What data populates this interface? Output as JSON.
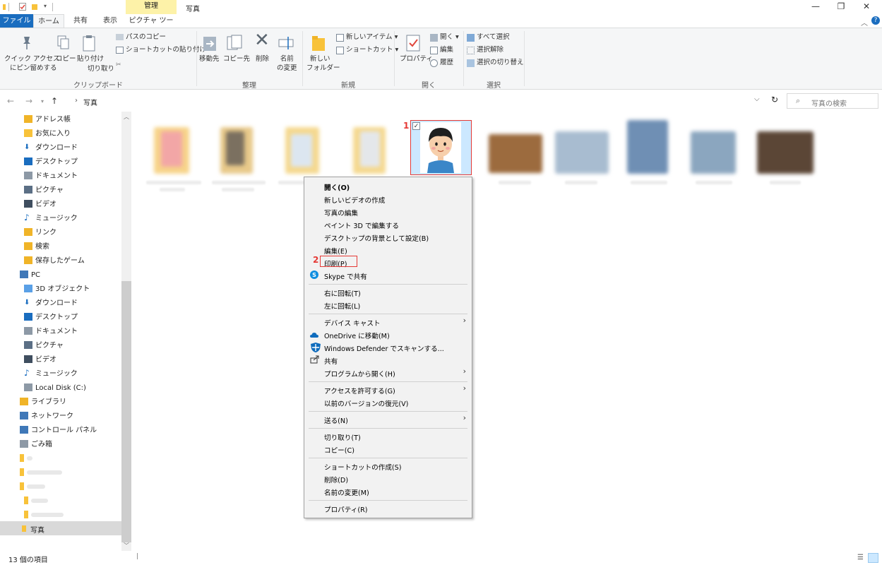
{
  "window": {
    "title": "写真",
    "manage_label": "管理",
    "minimize": "—",
    "maximize": "❐",
    "close": "✕"
  },
  "tabs": {
    "file": "ファイル",
    "home": "ホーム",
    "share": "共有",
    "view": "表示",
    "picture_tools": "ピクチャ ツール"
  },
  "ribbon": {
    "clipboard": {
      "pin_quick_access": "クイック アクセス\nにピン留めする",
      "pin_line1": "クイック アクセス",
      "pin_line2": "にピン留めする",
      "copy": "コピー",
      "paste": "貼り付け",
      "copy_path": "パスのコピー",
      "paste_shortcut": "ショートカットの貼り付け",
      "cut": "切り取り",
      "group_label": "クリップボード"
    },
    "organize": {
      "move_to": "移動先",
      "copy_to": "コピー先",
      "delete": "削除",
      "rename_line1": "名前",
      "rename_line2": "の変更",
      "group_label": "整理"
    },
    "new": {
      "new_folder_line1": "新しい",
      "new_folder_line2": "フォルダー",
      "new_item": "新しいアイテム",
      "easy_access": "ショートカット",
      "group_label": "新規"
    },
    "open": {
      "properties": "プロパティ",
      "open": "開く",
      "edit": "編集",
      "history": "履歴",
      "group_label": "開く"
    },
    "select": {
      "select_all": "すべて選択",
      "select_none": "選択解除",
      "invert": "選択の切り替え",
      "group_label": "選択"
    }
  },
  "address": {
    "path": "写真",
    "search_placeholder": "写真の検索"
  },
  "navpane": {
    "items": [
      {
        "label": "アドレス帳",
        "icon": "address-book-icon",
        "indent": 1
      },
      {
        "label": "お気に入り",
        "icon": "favorites-folder-icon",
        "indent": 1
      },
      {
        "label": "ダウンロード",
        "icon": "download-icon",
        "indent": 1
      },
      {
        "label": "デスクトップ",
        "icon": "desktop-icon",
        "indent": 1
      },
      {
        "label": "ドキュメント",
        "icon": "document-icon",
        "indent": 1
      },
      {
        "label": "ピクチャ",
        "icon": "pictures-icon",
        "indent": 1
      },
      {
        "label": "ビデオ",
        "icon": "video-icon",
        "indent": 1
      },
      {
        "label": "ミュージック",
        "icon": "music-icon",
        "indent": 1
      },
      {
        "label": "リンク",
        "icon": "link-icon",
        "indent": 1
      },
      {
        "label": "検索",
        "icon": "search-folder-icon",
        "indent": 1
      },
      {
        "label": "保存したゲーム",
        "icon": "saved-games-icon",
        "indent": 1
      },
      {
        "label": "PC",
        "icon": "pc-icon",
        "indent": 0
      },
      {
        "label": "3D オブジェクト",
        "icon": "3d-objects-icon",
        "indent": 1
      },
      {
        "label": "ダウンロード",
        "icon": "download-icon",
        "indent": 1
      },
      {
        "label": "デスクトップ",
        "icon": "desktop-icon",
        "indent": 1
      },
      {
        "label": "ドキュメント",
        "icon": "document-icon",
        "indent": 1
      },
      {
        "label": "ピクチャ",
        "icon": "pictures-icon",
        "indent": 1
      },
      {
        "label": "ビデオ",
        "icon": "video-icon",
        "indent": 1
      },
      {
        "label": "ミュージック",
        "icon": "music-icon",
        "indent": 1
      },
      {
        "label": "Local Disk (C:)",
        "icon": "disk-icon",
        "indent": 1
      },
      {
        "label": "ライブラリ",
        "icon": "library-icon",
        "indent": 0
      },
      {
        "label": "ネットワーク",
        "icon": "network-icon",
        "indent": 0
      },
      {
        "label": "コントロール パネル",
        "icon": "control-panel-icon",
        "indent": 0
      },
      {
        "label": "ごみ箱",
        "icon": "recycle-bin-icon",
        "indent": 0
      }
    ],
    "selected": "写真"
  },
  "context_menu": {
    "open": "開く(O)",
    "new_video": "新しいビデオの作成",
    "edit_photo": "写真の編集",
    "edit_paint3d": "ペイント 3D で編集する",
    "set_desktop_bg": "デスクトップの背景として設定(B)",
    "edit": "編集(E)",
    "print": "印刷(P)",
    "skype_share": "Skype で共有",
    "rotate_right": "右に回転(T)",
    "rotate_left": "左に回転(L)",
    "cast_to_device": "デバイス キャスト",
    "move_onedrive": "OneDrive に移動(M)",
    "defender_scan": "Windows Defender でスキャンする...",
    "share": "共有",
    "open_with": "プログラムから開く(H)",
    "give_access": "アクセスを許可する(G)",
    "restore_versions": "以前のバージョンの復元(V)",
    "send_to": "送る(N)",
    "cut": "切り取り(T)",
    "copy": "コピー(C)",
    "create_shortcut": "ショートカットの作成(S)",
    "delete": "削除(D)",
    "rename": "名前の変更(M)",
    "properties": "プロパティ(R)"
  },
  "annotations": {
    "step1": "1",
    "step2": "2"
  },
  "status": {
    "item_count": "13 個の項目"
  },
  "colors": {
    "accent": "#1a6dbf",
    "annotation_red": "#e53935",
    "selection": "#cce8ff"
  }
}
